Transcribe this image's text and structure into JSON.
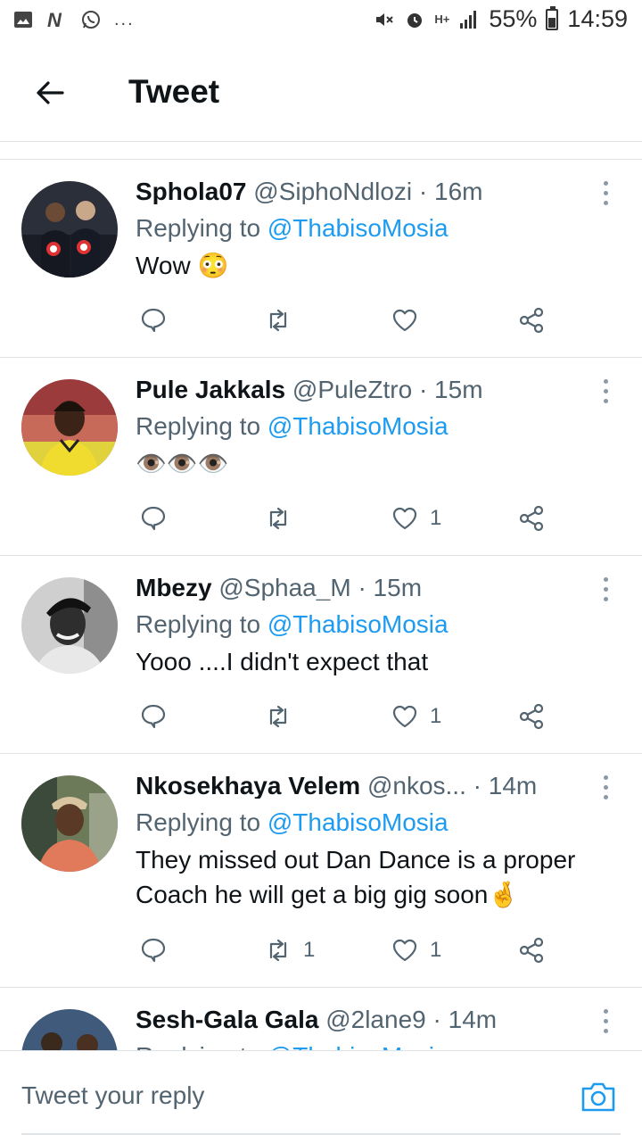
{
  "status_bar": {
    "battery": "55%",
    "time": "14:59",
    "network": "H+",
    "more": "..."
  },
  "header": {
    "title": "Tweet"
  },
  "tweets": [
    {
      "name": "Sphola07",
      "handle": "@SiphoNdlozi",
      "time": "16m",
      "replying_prefix": "Replying to",
      "replying_to": "@ThabisoMosia",
      "text": "Wow 😳",
      "retweets": "",
      "likes": ""
    },
    {
      "name": "Pule Jakkals",
      "handle": "@PuleZtro",
      "time": "15m",
      "replying_prefix": "Replying to",
      "replying_to": "@ThabisoMosia",
      "text": "👁️👁️👁️",
      "retweets": "",
      "likes": "1"
    },
    {
      "name": "Mbezy",
      "handle": "@Sphaa_M",
      "time": "15m",
      "replying_prefix": "Replying to",
      "replying_to": "@ThabisoMosia",
      "text": "Yooo ....I didn't expect that",
      "retweets": "",
      "likes": "1"
    },
    {
      "name": "Nkosekhaya Velem",
      "handle": "@nkos...",
      "time": "14m",
      "replying_prefix": "Replying to",
      "replying_to": "@ThabisoMosia",
      "text": "They missed out Dan Dance is a proper Coach he will get a big gig soon🤞",
      "retweets": "1",
      "likes": "1"
    },
    {
      "name": "Sesh-Gala Gala",
      "handle": "@2lane9",
      "time": "14m",
      "replying_prefix": "Replying to",
      "replying_to": "@ThabisoMosia",
      "text": "",
      "retweets": "",
      "likes": ""
    }
  ],
  "separator": "·",
  "reply_bar": {
    "placeholder": "Tweet your reply"
  },
  "colors": {
    "link": "#1d9bf0",
    "secondary_text": "#536471",
    "divider": "#dfe3e6"
  }
}
